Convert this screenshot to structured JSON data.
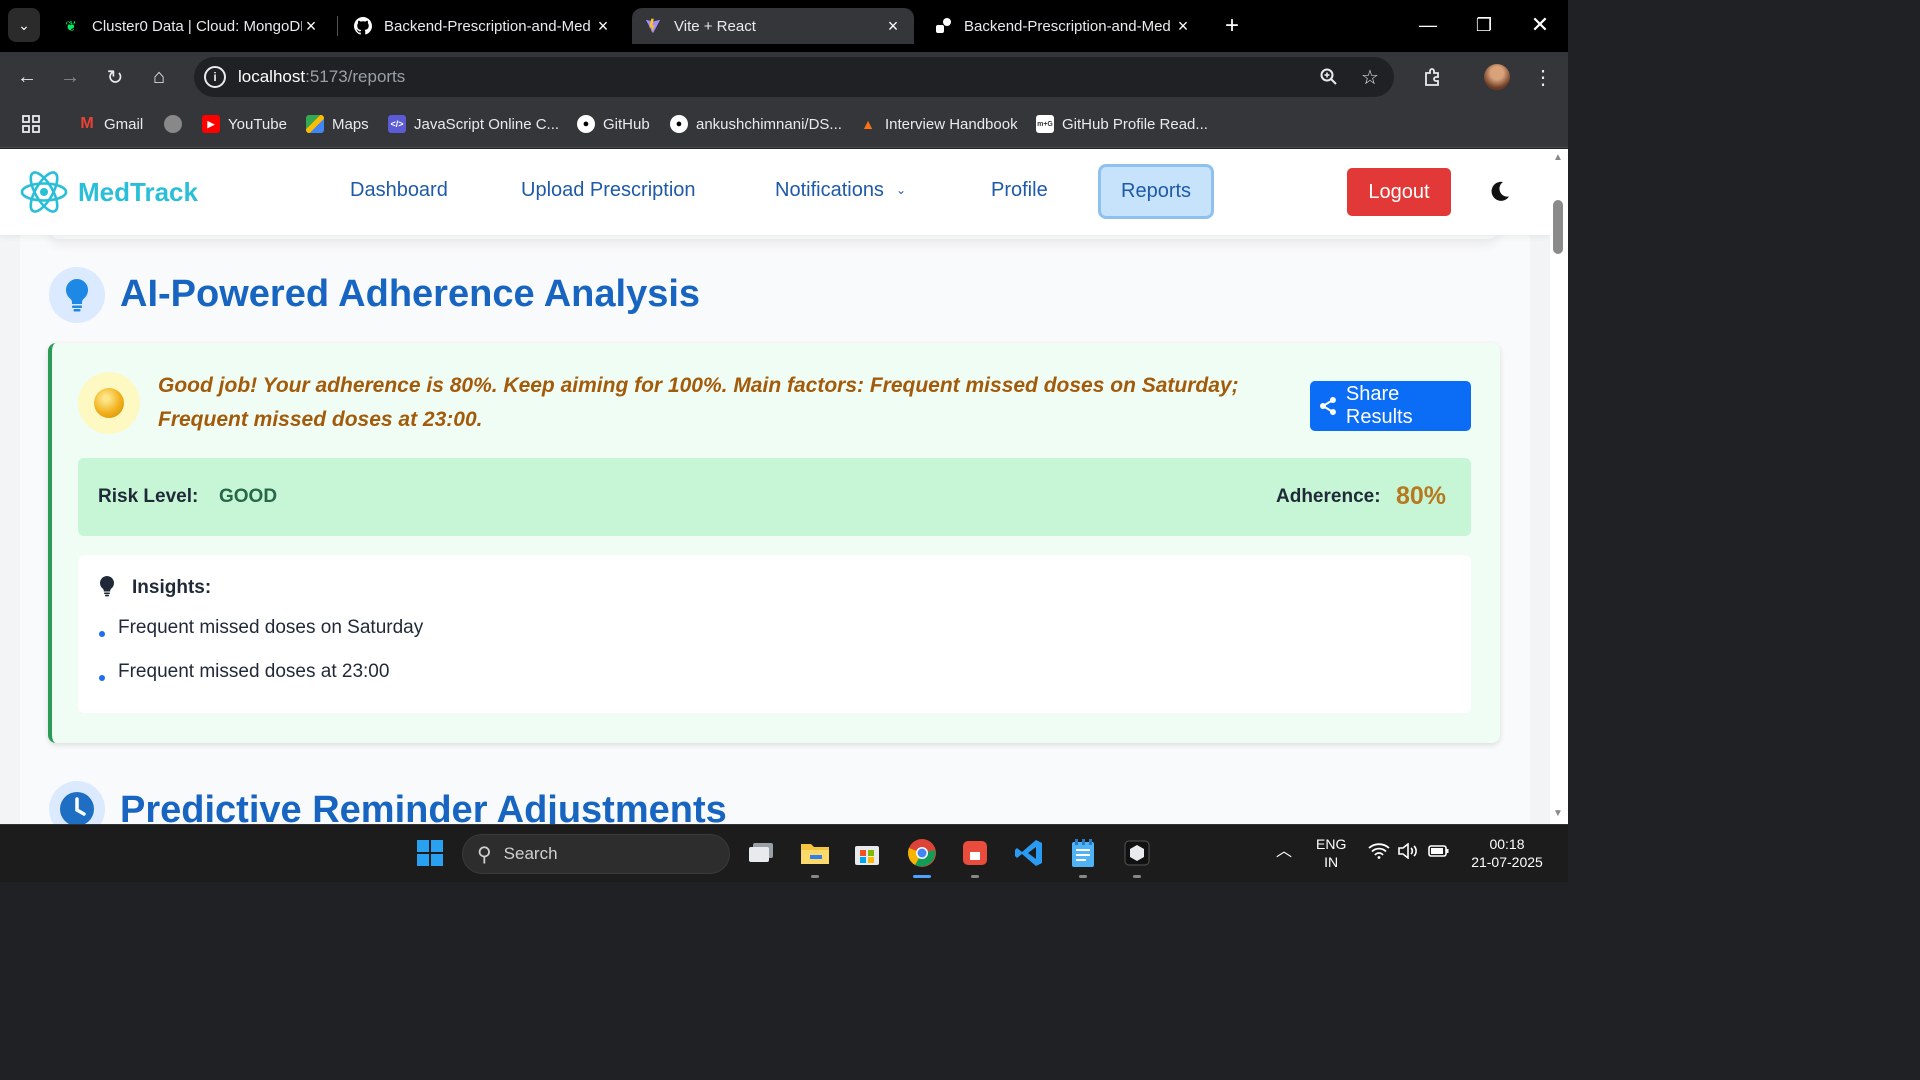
{
  "browser": {
    "tabs": [
      {
        "title": "Cluster0 Data | Cloud: MongoDB",
        "active": false
      },
      {
        "title": "Backend-Prescription-and-Med",
        "active": false
      },
      {
        "title": "Vite + React",
        "active": true
      },
      {
        "title": "Backend-Prescription-and-Med",
        "active": false
      }
    ],
    "url_host": "localhost",
    "url_path": ":5173/reports",
    "bookmarks": [
      {
        "label": "Gmail"
      },
      {
        "label": "YouTube"
      },
      {
        "label": "Maps"
      },
      {
        "label": "JavaScript Online C..."
      },
      {
        "label": "GitHub"
      },
      {
        "label": "ankushchimnani/DS..."
      },
      {
        "label": "Interview Handbook"
      },
      {
        "label": "GitHub Profile Read..."
      }
    ]
  },
  "navbar": {
    "brand": "MedTrack",
    "links": [
      "Dashboard",
      "Upload Prescription",
      "Notifications",
      "Profile",
      "Reports"
    ],
    "active_link": "Reports",
    "logout": "Logout"
  },
  "analysis": {
    "title": "AI-Powered Adherence Analysis",
    "message": "Good job! Your adherence is 80%. Keep aiming for 100%. Main factors: Frequent missed doses on Saturday; Frequent missed doses at 23:00.",
    "share_label": "Share Results",
    "risk_label": "Risk Level:",
    "risk_value": "GOOD",
    "adherence_label": "Adherence:",
    "adherence_value": "80%",
    "insights_title": "Insights:",
    "insights": [
      "Frequent missed doses on Saturday",
      "Frequent missed doses at 23:00"
    ]
  },
  "next_section": {
    "title": "Predictive Reminder Adjustments"
  },
  "taskbar": {
    "search_placeholder": "Search",
    "lang_1": "ENG",
    "lang_2": "IN",
    "time": "00:18",
    "date": "21-07-2025"
  },
  "colors": {
    "brand": "#2abfd8",
    "link": "#1e5aa8",
    "heading": "#1765c1",
    "logout": "#e23838",
    "share": "#0b6cf5",
    "message": "#a35b0b",
    "risk_good": "#276749",
    "adherence": "#b7791f"
  }
}
